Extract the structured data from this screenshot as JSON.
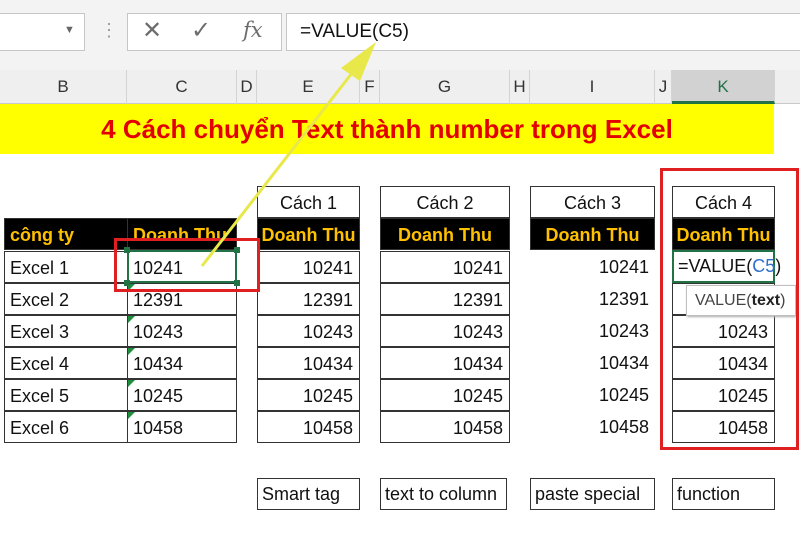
{
  "formula_bar": {
    "cancel_icon": "✕",
    "enter_icon": "✓",
    "fx_label": "fx",
    "formula_text": "=VALUE(C5)"
  },
  "column_headers": [
    "B",
    "C",
    "D",
    "E",
    "F",
    "G",
    "H",
    "I",
    "J",
    "K"
  ],
  "title": "4 Cách chuyển Text thành number trong Excel",
  "source_table": {
    "headers": [
      "công ty",
      "Doanh Thu"
    ],
    "rows": [
      {
        "company": "Excel 1",
        "value": "10241"
      },
      {
        "company": "Excel 2",
        "value": "12391"
      },
      {
        "company": "Excel 3",
        "value": "10243"
      },
      {
        "company": "Excel 4",
        "value": "10434"
      },
      {
        "company": "Excel 5",
        "value": "10245"
      },
      {
        "company": "Excel 6",
        "value": "10458"
      }
    ]
  },
  "methods": [
    {
      "caption": "Cách 1",
      "header": "Doanh Thu",
      "values": [
        "10241",
        "12391",
        "10243",
        "10434",
        "10245",
        "10458"
      ],
      "label": "Smart tag"
    },
    {
      "caption": "Cách 2",
      "header": "Doanh Thu",
      "values": [
        "10241",
        "12391",
        "10243",
        "10434",
        "10245",
        "10458"
      ],
      "label": "text to column"
    },
    {
      "caption": "Cách 3",
      "header": "Doanh Thu",
      "values": [
        "10241",
        "12391",
        "10243",
        "10434",
        "10245",
        "10458"
      ],
      "label": "paste special"
    },
    {
      "caption": "Cách 4",
      "header": "Doanh Thu",
      "editing": {
        "prefix": "=VALUE(",
        "ref": "C5",
        "suffix": ")"
      },
      "values": [
        "",
        "",
        "10243",
        "10434",
        "10245",
        "10458"
      ],
      "label": "function"
    }
  ],
  "tooltip": {
    "fn": "VALUE(",
    "arg": "text",
    "close": ")"
  },
  "colors": {
    "title_bg": "#ffff00",
    "title_text": "#e30000",
    "header_bg": "#000000",
    "header_text": "#ffc000",
    "highlight": "#e02020",
    "selection": "#217346",
    "arrow": "#e8e84a"
  }
}
